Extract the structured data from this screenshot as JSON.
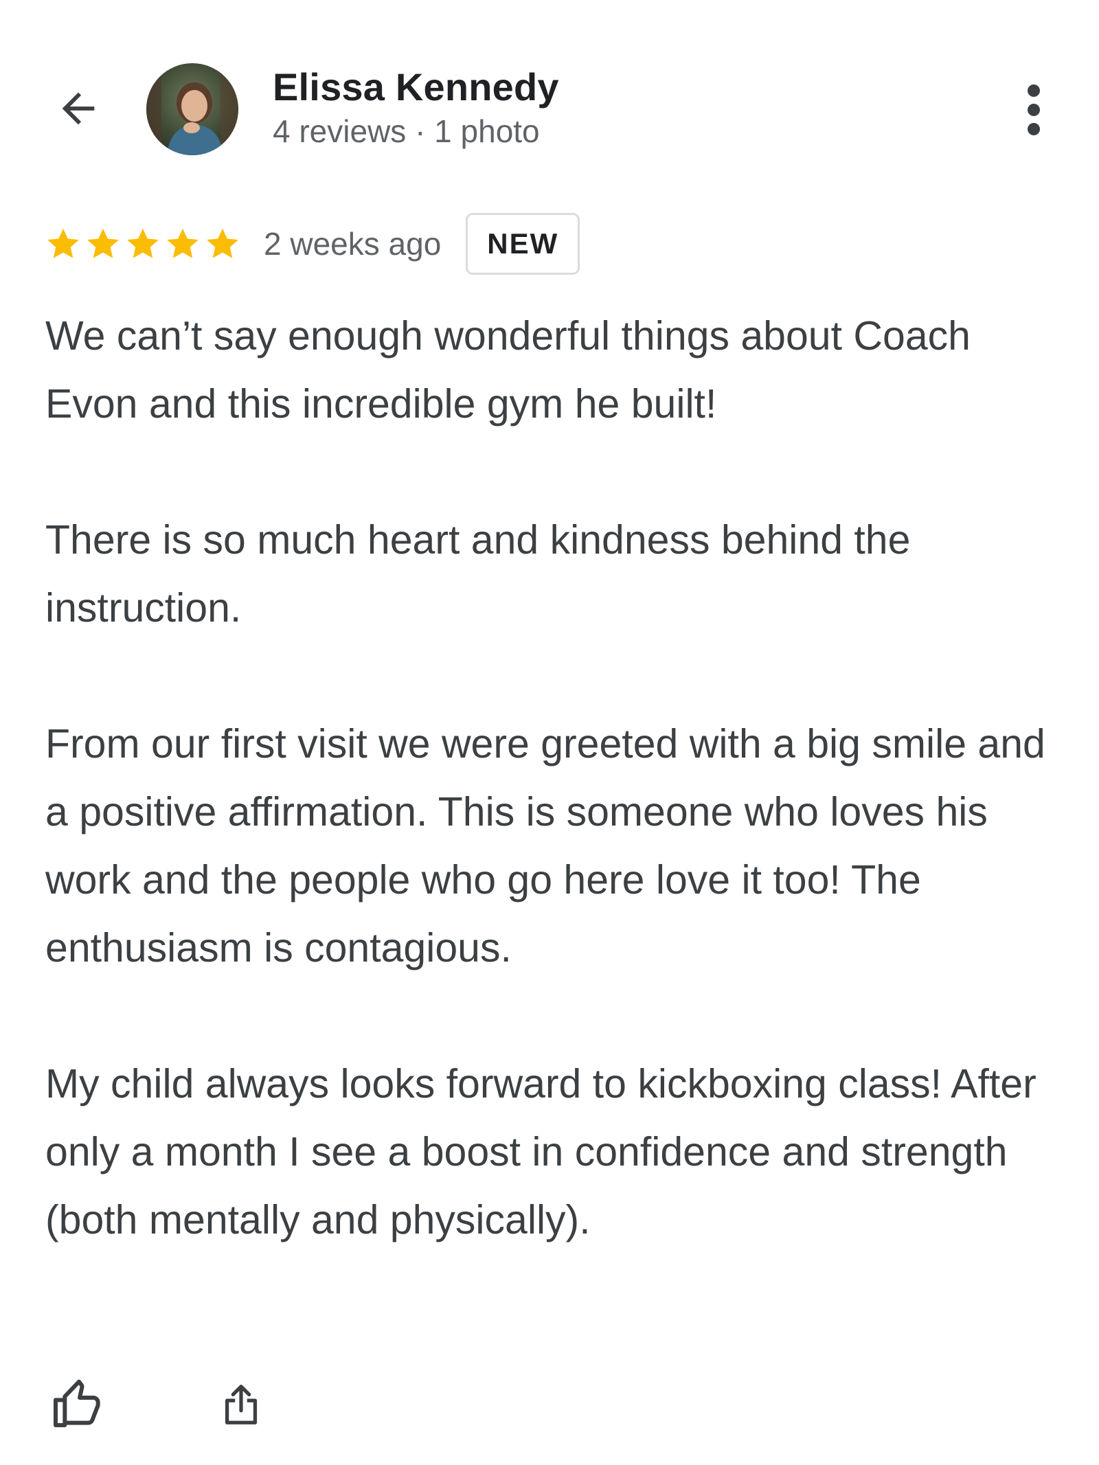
{
  "header": {
    "back_icon": "arrow-left-icon",
    "author_name": "Elissa Kennedy",
    "author_meta": "4 reviews · 1 photo",
    "more_icon": "more-vertical-icon"
  },
  "review": {
    "rating": 5,
    "rating_max": 5,
    "date": "2 weeks ago",
    "badge": "NEW",
    "paragraphs": [
      "We can’t say enough wonderful things about Coach Evon and this incredible gym he built!",
      "There is so much heart and kindness behind the instruction.",
      "From our first visit we were greeted with a big smile and a positive affirmation. This is someone who loves his work and the people who go here love it too! The enthusiasm is contagious.",
      "My child always looks forward to kickboxing class! After only a month I see a boost in confidence and strength (both mentally and physically)."
    ]
  },
  "actions": {
    "like_icon": "thumbs-up-icon",
    "share_icon": "share-icon"
  },
  "colors": {
    "star": "#fbbc04",
    "text": "#3c4043",
    "name": "#202124",
    "meta": "#5f6368",
    "badge_border": "#dadce0"
  }
}
